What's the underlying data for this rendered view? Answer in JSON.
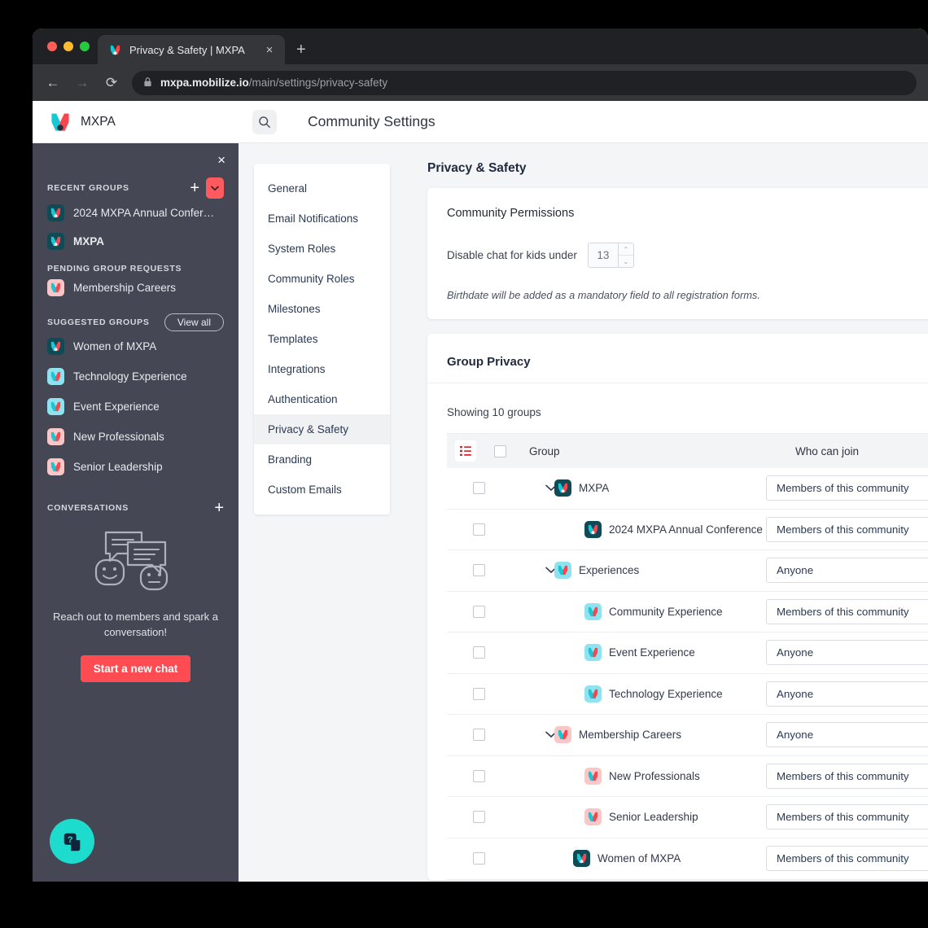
{
  "browser": {
    "tab_title": "Privacy & Safety | MXPA",
    "tab_close_label": "×",
    "new_tab_label": "+",
    "back_label": "←",
    "forward_label": "→",
    "reload_label": "⟳",
    "lock_icon": "lock-icon",
    "url_domain": "mxpa.mobilize.io",
    "url_path": "/main/settings/privacy-safety"
  },
  "appbar": {
    "brand_name": "MXPA",
    "search_icon": "search-icon",
    "page_heading": "Community Settings"
  },
  "sidebar": {
    "close_label": "×",
    "recent_groups_label": "RECENT GROUPS",
    "add_label": "+",
    "dropdown_caret": "⌄",
    "recent_groups": [
      {
        "name": "2024 MXPA Annual Confer…",
        "bold": false,
        "tile": "dark-teal"
      },
      {
        "name": "MXPA",
        "bold": true,
        "tile": "dark-teal"
      }
    ],
    "pending_label": "PENDING GROUP REQUESTS",
    "pending_groups": [
      {
        "name": "Membership Careers",
        "bold": false,
        "tile": "pink"
      }
    ],
    "suggested_label": "SUGGESTED GROUPS",
    "view_all_label": "View all",
    "suggested_groups": [
      {
        "name": "Women of MXPA",
        "bold": false,
        "tile": "dark-teal"
      },
      {
        "name": "Technology Experience",
        "bold": false,
        "tile": "cyan"
      },
      {
        "name": "Event Experience",
        "bold": false,
        "tile": "cyan"
      },
      {
        "name": "New Professionals",
        "bold": false,
        "tile": "pink"
      },
      {
        "name": "Senior Leadership",
        "bold": false,
        "tile": "pink"
      }
    ],
    "conversations_label": "CONVERSATIONS",
    "conversations_add_label": "+",
    "empty_illustration": "chat-bubbles-illustration",
    "empty_text": "Reach out to members and spark a conversation!",
    "start_chat_label": "Start a new chat",
    "help_icon": "help-question-icon"
  },
  "settings_nav": {
    "items": [
      {
        "label": "General",
        "active": false
      },
      {
        "label": "Email Notifications",
        "active": false
      },
      {
        "label": "System Roles",
        "active": false
      },
      {
        "label": "Community Roles",
        "active": false
      },
      {
        "label": "Milestones",
        "active": false
      },
      {
        "label": "Templates",
        "active": false
      },
      {
        "label": "Integrations",
        "active": false
      },
      {
        "label": "Authentication",
        "active": false
      },
      {
        "label": "Privacy & Safety",
        "active": true
      },
      {
        "label": "Branding",
        "active": false
      },
      {
        "label": "Custom Emails",
        "active": false
      }
    ]
  },
  "main": {
    "title": "Privacy & Safety",
    "permissions": {
      "heading": "Community Permissions",
      "disable_chat_label": "Disable chat for kids under",
      "age_value": "13",
      "spin_up": "⌃",
      "spin_down": "⌄",
      "note": "Birthdate will be added as a mandatory field to all registration forms."
    },
    "group_privacy": {
      "heading": "Group Privacy",
      "showing": "Showing 10 groups",
      "list_icon": "list-view-icon",
      "columns": {
        "group": "Group",
        "who_can_join": "Who can join"
      },
      "rows": [
        {
          "name": "MXPA",
          "level": 0,
          "expandable": true,
          "tile": "dark-teal",
          "access": "Members of this community"
        },
        {
          "name": "2024 MXPA Annual Conference",
          "level": 1,
          "expandable": false,
          "tile": "dark-teal",
          "access": "Members of this community"
        },
        {
          "name": "Experiences",
          "level": 0,
          "expandable": true,
          "tile": "cyan",
          "access": "Anyone"
        },
        {
          "name": "Community Experience",
          "level": 1,
          "expandable": false,
          "tile": "cyan",
          "access": "Members of this community"
        },
        {
          "name": "Event Experience",
          "level": 1,
          "expandable": false,
          "tile": "cyan",
          "access": "Anyone"
        },
        {
          "name": "Technology Experience",
          "level": 1,
          "expandable": false,
          "tile": "cyan",
          "access": "Anyone"
        },
        {
          "name": "Membership Careers",
          "level": 0,
          "expandable": true,
          "tile": "pink",
          "access": "Anyone"
        },
        {
          "name": "New Professionals",
          "level": 1,
          "expandable": false,
          "tile": "pink",
          "access": "Members of this community"
        },
        {
          "name": "Senior Leadership",
          "level": 1,
          "expandable": false,
          "tile": "pink",
          "access": "Members of this community"
        },
        {
          "name": "Women of MXPA",
          "level": 1,
          "expandable": false,
          "tile": "dark-teal",
          "access": "Members of this community"
        }
      ],
      "chevron_expanded": "⌄",
      "select_caret": "⌄"
    }
  },
  "colors": {
    "accent_red": "#ff4b52",
    "sidebar_bg": "#454754",
    "teal": "#1ddccd",
    "logo_cyan": "#14c8d4",
    "logo_red": "#f8464f",
    "tile_dark_teal": "#0f4b56",
    "tile_cyan": "#8fe3f0",
    "tile_pink": "#f9c7c7"
  }
}
